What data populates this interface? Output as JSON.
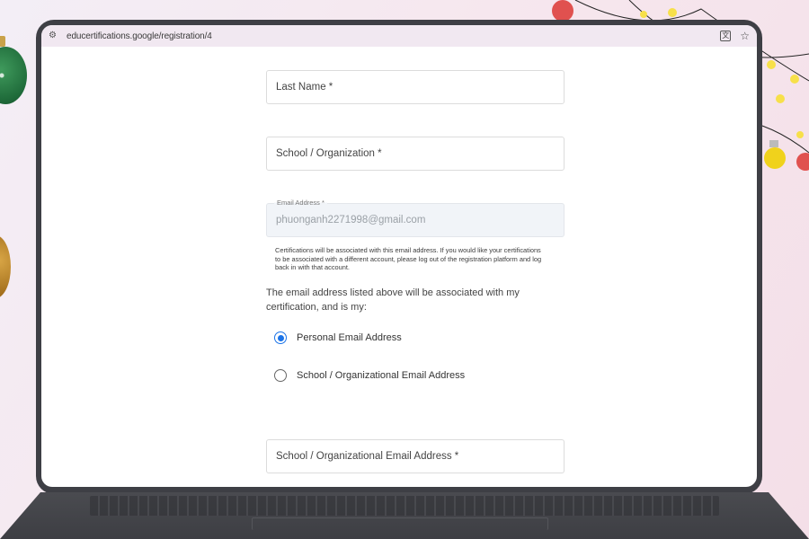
{
  "browser": {
    "url": "educertifications.google/registration/4",
    "icons": {
      "site_settings": "tune-icon",
      "translate": "translate-icon",
      "bookmark": "star-icon"
    }
  },
  "form": {
    "last_name_placeholder": "Last Name *",
    "school_placeholder": "School / Organization *",
    "email_label": "Email Address *",
    "email_value": "phuonganh2271998@gmail.com",
    "email_helper": "Certifications will be associated with this email address. If you would like your certifications to be associated with a different account, please log out of the registration platform and log back in with that account.",
    "question": "The email address listed above will be associated with my certification, and is my:",
    "options": [
      {
        "label": "Personal Email Address",
        "selected": true
      },
      {
        "label": "School / Organizational Email Address",
        "selected": false
      }
    ],
    "school_email_placeholder": "School / Organizational Email Address *"
  },
  "colors": {
    "accent": "#1a73e8",
    "frame": "#3e3f45",
    "url_bar": "#f1e8f1"
  }
}
